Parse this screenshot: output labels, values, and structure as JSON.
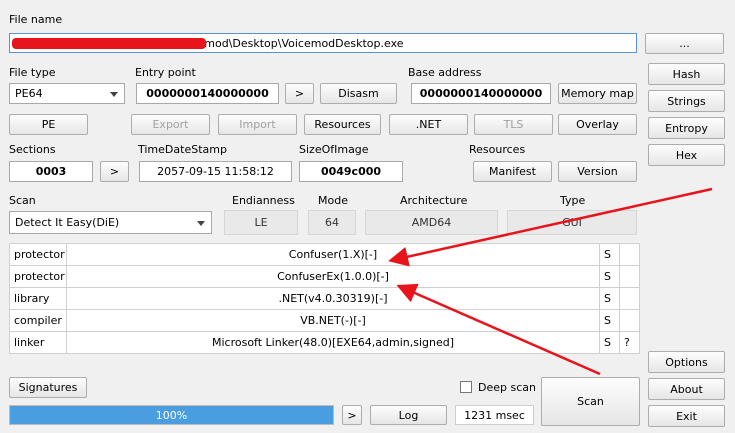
{
  "file": {
    "label": "File name",
    "path": "C:\\Users\\user\\AppData\\Local\\Voicemod\\Desktop\\VoicemodDesktop.exe",
    "browse": "..."
  },
  "filetype": {
    "label": "File type",
    "value": "PE64"
  },
  "entry": {
    "label": "Entry point",
    "value": "0000000140000000",
    "go": ">",
    "disasm": "Disasm"
  },
  "base": {
    "label": "Base address",
    "value": "0000000140000000",
    "memmap": "Memory map"
  },
  "right": {
    "hash": "Hash",
    "strings": "Strings",
    "entropy": "Entropy",
    "hex": "Hex"
  },
  "row2": {
    "pe": "PE",
    "export": "Export",
    "import": "Import",
    "resources": "Resources",
    "net": ".NET",
    "tls": "TLS",
    "overlay": "Overlay"
  },
  "sections": {
    "label": "Sections",
    "value": "0003",
    "go": ">"
  },
  "timestamp": {
    "label": "TimeDateStamp",
    "value": "2057-09-15 11:58:12"
  },
  "size": {
    "label": "SizeOfImage",
    "value": "0049c000"
  },
  "resources": {
    "label": "Resources",
    "manifest": "Manifest",
    "version": "Version"
  },
  "scan": {
    "label": "Scan",
    "value": "Detect It Easy(DiE)"
  },
  "endianness": {
    "label": "Endianness",
    "value": "LE"
  },
  "mode": {
    "label": "Mode",
    "value": "64"
  },
  "arch": {
    "label": "Architecture",
    "value": "AMD64"
  },
  "type": {
    "label": "Type",
    "value": "GUI"
  },
  "results": [
    {
      "kind": "protector",
      "name": "Confuser(1.X)[-]",
      "s": "S",
      "q": ""
    },
    {
      "kind": "protector",
      "name": "ConfuserEx(1.0.0)[-]",
      "s": "S",
      "q": ""
    },
    {
      "kind": "library",
      "name": ".NET(v4.0.30319)[-]",
      "s": "S",
      "q": ""
    },
    {
      "kind": "compiler",
      "name": "VB.NET(-)[-]",
      "s": "S",
      "q": ""
    },
    {
      "kind": "linker",
      "name": "Microsoft Linker(48.0)[EXE64,admin,signed]",
      "s": "S",
      "q": "?"
    }
  ],
  "bottom": {
    "signatures": "Signatures",
    "deepscan": "Deep scan",
    "progress": "100%",
    "go": ">",
    "log": "Log",
    "time": "1231 msec",
    "scan": "Scan",
    "options": "Options",
    "about": "About",
    "exit": "Exit"
  },
  "colors": {
    "progress": "#4a9ee0",
    "annotation": "#e8141c"
  }
}
